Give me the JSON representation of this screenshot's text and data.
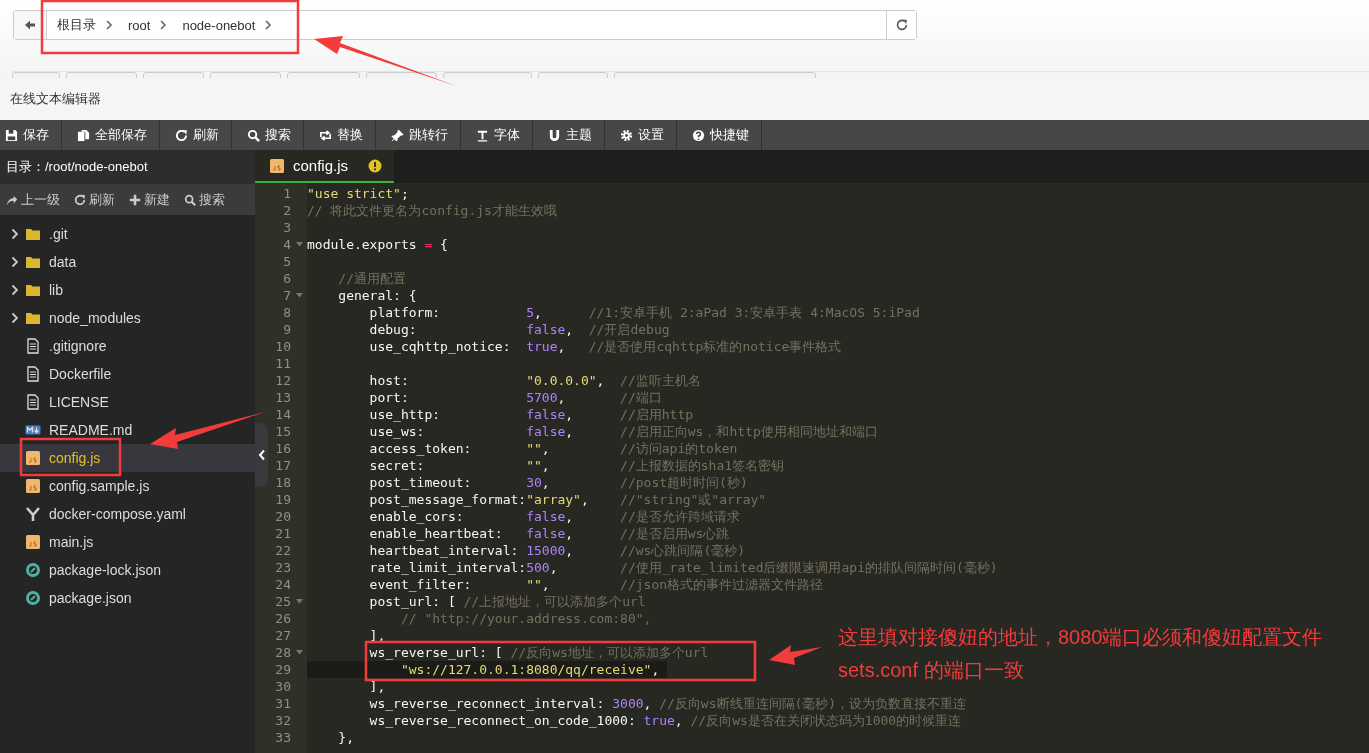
{
  "nav": {
    "breadcrumb": [
      "根目录",
      "root",
      "node-onebot"
    ]
  },
  "panel_title": "在线文本编辑器",
  "toolbar": [
    {
      "label": "保存",
      "kind": "save"
    },
    {
      "label": "全部保存",
      "kind": "saveall"
    },
    {
      "label": "刷新",
      "kind": "refresh"
    },
    {
      "label": "搜索",
      "kind": "search"
    },
    {
      "label": "替换",
      "kind": "replace"
    },
    {
      "label": "跳转行",
      "kind": "goto"
    },
    {
      "label": "字体",
      "kind": "font"
    },
    {
      "label": "主题",
      "kind": "theme"
    },
    {
      "label": "设置",
      "kind": "settings"
    },
    {
      "label": "快捷键",
      "kind": "keys"
    }
  ],
  "sidebar": {
    "title": "目录：/root/node-onebot",
    "actions": [
      {
        "label": "上一级",
        "kind": "up"
      },
      {
        "label": "刷新",
        "kind": "refresh"
      },
      {
        "label": "新建",
        "kind": "new"
      },
      {
        "label": "搜索",
        "kind": "search"
      }
    ],
    "items": [
      {
        "label": ".git",
        "kind": "folder",
        "selected": false
      },
      {
        "label": "data",
        "kind": "folder",
        "selected": false
      },
      {
        "label": "lib",
        "kind": "folder",
        "selected": false
      },
      {
        "label": "node_modules",
        "kind": "folder",
        "selected": false
      },
      {
        "label": ".gitignore",
        "kind": "text",
        "selected": false
      },
      {
        "label": "Dockerfile",
        "kind": "text",
        "selected": false
      },
      {
        "label": "LICENSE",
        "kind": "text",
        "selected": false
      },
      {
        "label": "README.md",
        "kind": "markdown",
        "selected": false
      },
      {
        "label": "config.js",
        "kind": "js",
        "selected": true
      },
      {
        "label": "config.sample.js",
        "kind": "js",
        "selected": false
      },
      {
        "label": "docker-compose.yaml",
        "kind": "yaml",
        "selected": false
      },
      {
        "label": "main.js",
        "kind": "js",
        "selected": false
      },
      {
        "label": "package-lock.json",
        "kind": "json",
        "selected": false
      },
      {
        "label": "package.json",
        "kind": "json",
        "selected": false
      }
    ]
  },
  "editor": {
    "tab": {
      "label": "config.js",
      "warning": true
    },
    "lines": [
      {
        "n": "1",
        "fold": false,
        "current": false,
        "tokens": [
          {
            "kind": "str",
            "text": "\"use strict\""
          },
          {
            "kind": "p",
            "text": ";"
          }
        ]
      },
      {
        "n": "2",
        "fold": false,
        "current": false,
        "tokens": [
          {
            "kind": "cm",
            "text": "// 将此文件更名为config.js才能生效哦"
          }
        ]
      },
      {
        "n": "3",
        "fold": false,
        "current": false
      },
      {
        "n": "4",
        "fold": true,
        "current": false,
        "tokens": [
          {
            "kind": "p",
            "text": "module.exports "
          },
          {
            "kind": "op",
            "text": "="
          },
          {
            "kind": "p",
            "text": " {"
          }
        ]
      },
      {
        "n": "5",
        "fold": false,
        "current": false
      },
      {
        "n": "6",
        "fold": false,
        "current": false,
        "tokens": [
          {
            "kind": "cm",
            "text": "    //通用配置"
          }
        ]
      },
      {
        "n": "7",
        "fold": true,
        "current": false,
        "tokens": [
          {
            "kind": "p",
            "text": "    general: {"
          }
        ]
      },
      {
        "n": "8",
        "fold": false,
        "current": false,
        "tokens": [
          {
            "kind": "p",
            "text": "        platform:           "
          },
          {
            "kind": "num",
            "text": "5"
          },
          {
            "kind": "p",
            "text": ",      "
          },
          {
            "kind": "cm",
            "text": "//1:安卓手机 2:aPad 3:安卓手表 4:MacOS 5:iPad"
          }
        ]
      },
      {
        "n": "9",
        "fold": false,
        "current": false,
        "tokens": [
          {
            "kind": "p",
            "text": "        debug:              "
          },
          {
            "kind": "num",
            "text": "false"
          },
          {
            "kind": "p",
            "text": ",  "
          },
          {
            "kind": "cm",
            "text": "//开启debug"
          }
        ]
      },
      {
        "n": "10",
        "fold": false,
        "current": false,
        "tokens": [
          {
            "kind": "p",
            "text": "        use_cqhttp_notice:  "
          },
          {
            "kind": "num",
            "text": "true"
          },
          {
            "kind": "p",
            "text": ",   "
          },
          {
            "kind": "cm",
            "text": "//是否使用cqhttp标准的notice事件格式"
          }
        ]
      },
      {
        "n": "11",
        "fold": false,
        "current": false
      },
      {
        "n": "12",
        "fold": false,
        "current": false,
        "tokens": [
          {
            "kind": "p",
            "text": "        host:               "
          },
          {
            "kind": "str",
            "text": "\"0.0.0.0\""
          },
          {
            "kind": "p",
            "text": ",  "
          },
          {
            "kind": "cm",
            "text": "//监听主机名"
          }
        ]
      },
      {
        "n": "13",
        "fold": false,
        "current": false,
        "tokens": [
          {
            "kind": "p",
            "text": "        port:               "
          },
          {
            "kind": "num",
            "text": "5700"
          },
          {
            "kind": "p",
            "text": ",       "
          },
          {
            "kind": "cm",
            "text": "//端口"
          }
        ]
      },
      {
        "n": "14",
        "fold": false,
        "current": false,
        "tokens": [
          {
            "kind": "p",
            "text": "        use_http:           "
          },
          {
            "kind": "num",
            "text": "false"
          },
          {
            "kind": "p",
            "text": ",      "
          },
          {
            "kind": "cm",
            "text": "//启用http"
          }
        ]
      },
      {
        "n": "15",
        "fold": false,
        "current": false,
        "tokens": [
          {
            "kind": "p",
            "text": "        use_ws:             "
          },
          {
            "kind": "num",
            "text": "false"
          },
          {
            "kind": "p",
            "text": ",      "
          },
          {
            "kind": "cm",
            "text": "//启用正向ws，和http使用相同地址和端口"
          }
        ]
      },
      {
        "n": "16",
        "fold": false,
        "current": false,
        "tokens": [
          {
            "kind": "p",
            "text": "        access_token:       "
          },
          {
            "kind": "str",
            "text": "\"\""
          },
          {
            "kind": "p",
            "text": ",         "
          },
          {
            "kind": "cm",
            "text": "//访问api的token"
          }
        ]
      },
      {
        "n": "17",
        "fold": false,
        "current": false,
        "tokens": [
          {
            "kind": "p",
            "text": "        secret:             "
          },
          {
            "kind": "str",
            "text": "\"\""
          },
          {
            "kind": "p",
            "text": ",         "
          },
          {
            "kind": "cm",
            "text": "//上报数据的sha1签名密钥"
          }
        ]
      },
      {
        "n": "18",
        "fold": false,
        "current": false,
        "tokens": [
          {
            "kind": "p",
            "text": "        post_timeout:       "
          },
          {
            "kind": "num",
            "text": "30"
          },
          {
            "kind": "p",
            "text": ",         "
          },
          {
            "kind": "cm",
            "text": "//post超时时间(秒)"
          }
        ]
      },
      {
        "n": "19",
        "fold": false,
        "current": false,
        "tokens": [
          {
            "kind": "p",
            "text": "        post_message_format:"
          },
          {
            "kind": "str",
            "text": "\"array\""
          },
          {
            "kind": "p",
            "text": ",    "
          },
          {
            "kind": "cm",
            "text": "//\"string\"或\"array\""
          }
        ]
      },
      {
        "n": "20",
        "fold": false,
        "current": false,
        "tokens": [
          {
            "kind": "p",
            "text": "        enable_cors:        "
          },
          {
            "kind": "num",
            "text": "false"
          },
          {
            "kind": "p",
            "text": ",      "
          },
          {
            "kind": "cm",
            "text": "//是否允许跨域请求"
          }
        ]
      },
      {
        "n": "21",
        "fold": false,
        "current": false,
        "tokens": [
          {
            "kind": "p",
            "text": "        enable_heartbeat:   "
          },
          {
            "kind": "num",
            "text": "false"
          },
          {
            "kind": "p",
            "text": ",      "
          },
          {
            "kind": "cm",
            "text": "//是否启用ws心跳"
          }
        ]
      },
      {
        "n": "22",
        "fold": false,
        "current": false,
        "tokens": [
          {
            "kind": "p",
            "text": "        heartbeat_interval: "
          },
          {
            "kind": "num",
            "text": "15000"
          },
          {
            "kind": "p",
            "text": ",      "
          },
          {
            "kind": "cm",
            "text": "//ws心跳间隔(毫秒)"
          }
        ]
      },
      {
        "n": "23",
        "fold": false,
        "current": false,
        "tokens": [
          {
            "kind": "p",
            "text": "        rate_limit_interval:"
          },
          {
            "kind": "num",
            "text": "500"
          },
          {
            "kind": "p",
            "text": ",        "
          },
          {
            "kind": "cm",
            "text": "//使用_rate_limited后缀限速调用api的排队间隔时间(毫秒)"
          }
        ]
      },
      {
        "n": "24",
        "fold": false,
        "current": false,
        "tokens": [
          {
            "kind": "p",
            "text": "        event_filter:       "
          },
          {
            "kind": "str",
            "text": "\"\""
          },
          {
            "kind": "p",
            "text": ",         "
          },
          {
            "kind": "cm",
            "text": "//json格式的事件过滤器文件路径"
          }
        ]
      },
      {
        "n": "25",
        "fold": true,
        "current": false,
        "tokens": [
          {
            "kind": "p",
            "text": "        post_url: [ "
          },
          {
            "kind": "cm",
            "text": "//上报地址，可以添加多个url"
          }
        ]
      },
      {
        "n": "26",
        "fold": false,
        "current": false,
        "tokens": [
          {
            "kind": "cm",
            "text": "            // \"http://your.address.com:80\","
          }
        ]
      },
      {
        "n": "27",
        "fold": false,
        "current": false,
        "tokens": [
          {
            "kind": "p",
            "text": "        ],"
          }
        ]
      },
      {
        "n": "28",
        "fold": true,
        "current": false,
        "tokens": [
          {
            "kind": "p",
            "text": "        ws_reverse_url: [ "
          },
          {
            "kind": "cm",
            "text": "//反向ws地址，可以添加多个url"
          }
        ]
      },
      {
        "n": "29",
        "fold": false,
        "current": true,
        "tokens": [
          {
            "kind": "str",
            "text": "            \"ws://127.0.0.1:8080/qq/receive\""
          },
          {
            "kind": "p",
            "text": ","
          }
        ]
      },
      {
        "n": "30",
        "fold": false,
        "current": false,
        "tokens": [
          {
            "kind": "p",
            "text": "        ],"
          }
        ]
      },
      {
        "n": "31",
        "fold": false,
        "current": false,
        "tokens": [
          {
            "kind": "p",
            "text": "        ws_reverse_reconnect_interval: "
          },
          {
            "kind": "num",
            "text": "3000"
          },
          {
            "kind": "p",
            "text": ", "
          },
          {
            "kind": "cm",
            "text": "//反向ws断线重连间隔(毫秒)，设为负数直接不重连"
          }
        ]
      },
      {
        "n": "32",
        "fold": false,
        "current": false,
        "tokens": [
          {
            "kind": "p",
            "text": "        ws_reverse_reconnect_on_code_1000: "
          },
          {
            "kind": "num",
            "text": "true"
          },
          {
            "kind": "p",
            "text": ", "
          },
          {
            "kind": "cm",
            "text": "//反向ws是否在关闭状态码为1000的时候重连"
          }
        ]
      },
      {
        "n": "33",
        "fold": false,
        "current": false,
        "tokens": [
          {
            "kind": "p",
            "text": "    },"
          }
        ]
      }
    ]
  },
  "annotation": {
    "note_lines": [
      "这里填对接傻妞的地址，8080端口必须和傻妞配置文件",
      "sets.conf 的端口一致"
    ]
  }
}
